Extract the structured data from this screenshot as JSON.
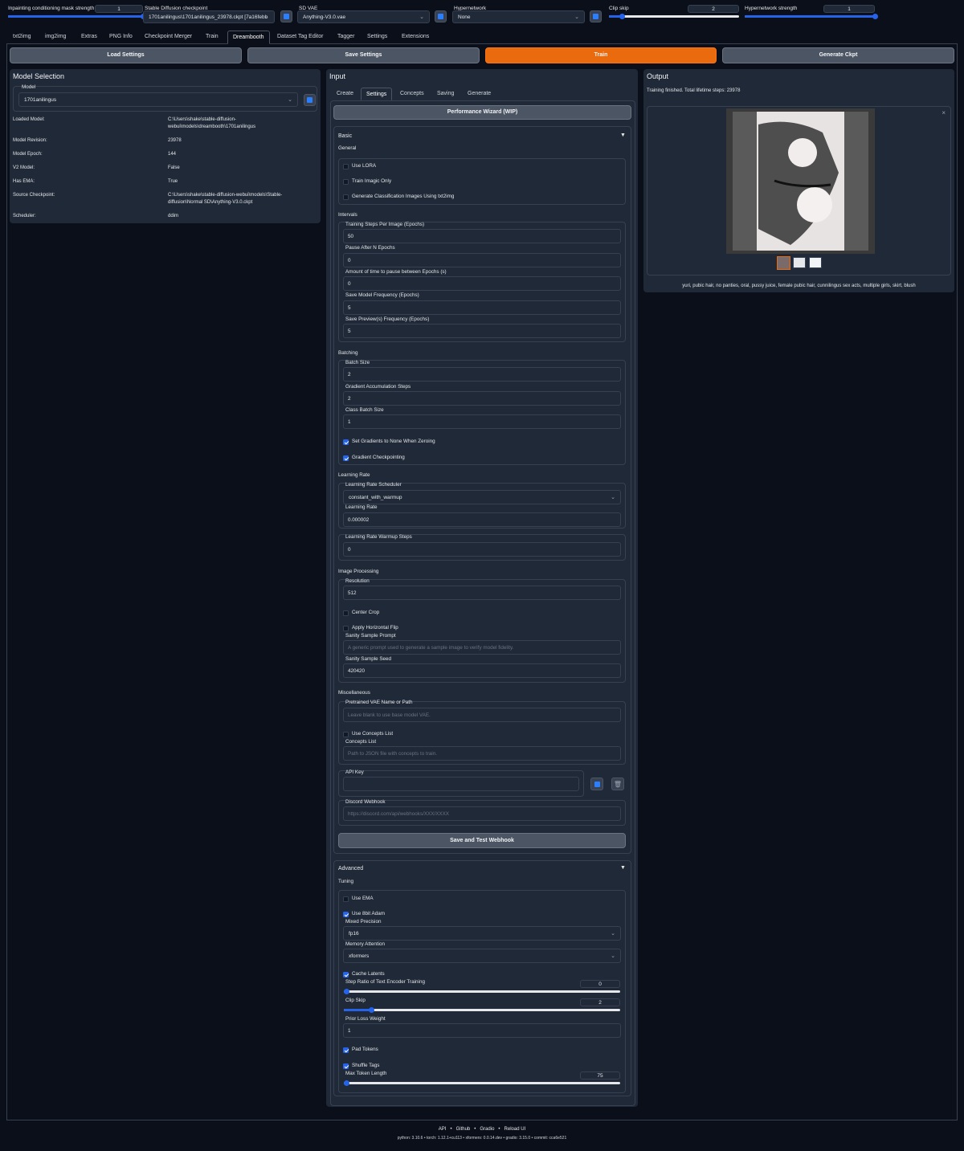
{
  "topbar": {
    "inpaint_label": "Inpainting conditioning mask strength",
    "inpaint_value": "1",
    "inpaint_level": 1.0,
    "ckpt_label": "Stable Diffusion checkpoint",
    "ckpt_value": "1701anilingus\\1701anilingus_23978.ckpt [7a16febb",
    "vae_label": "SD VAE",
    "vae_value": "Anything-V3.0.vae",
    "hyper_label": "Hypernetwork",
    "hyper_value": "None",
    "clipskip_label": "Clip skip",
    "clipskip_value": "2",
    "clipskip_level": 0.1,
    "hyperstr_label": "Hypernetwork strength",
    "hyperstr_value": "1",
    "hyperstr_level": 1.0
  },
  "tabs": [
    "txt2img",
    "img2img",
    "Extras",
    "PNG Info",
    "Checkpoint Merger",
    "Train",
    "Dreambooth",
    "Dataset Tag Editor",
    "Tagger",
    "Settings",
    "Extensions"
  ],
  "actions": {
    "load": "Load Settings",
    "save": "Save Settings",
    "train": "Train",
    "generate": "Generate Ckpt"
  },
  "model_selection": {
    "title": "Model Selection",
    "model_label": "Model",
    "model_value": "1701anilingus",
    "info": [
      {
        "k": "Loaded Model:",
        "v": "C:\\Users\\shake\\stable-diffusion-webui\\models\\dreambooth\\1701anilingus"
      },
      {
        "k": "Model Revision:",
        "v": "23978"
      },
      {
        "k": "Model Epoch:",
        "v": "144"
      },
      {
        "k": "V2 Model:",
        "v": "False"
      },
      {
        "k": "Has EMA:",
        "v": "True"
      },
      {
        "k": "Source Checkpoint:",
        "v": "C:\\Users\\shake\\stable-diffusion-webui\\models\\Stable-diffusion\\Normal SD\\Anything-V3.0.ckpt"
      },
      {
        "k": "Scheduler:",
        "v": "ddim"
      }
    ]
  },
  "input": {
    "title": "Input",
    "tabs": [
      "Create",
      "Settings",
      "Concepts",
      "Saving",
      "Generate"
    ],
    "wizard": "Performance Wizard (WIP)",
    "basic": "Basic",
    "general": "General",
    "use_lora": "Use LORA",
    "train_imagic": "Train Imagic Only",
    "gen_class": "Generate Classification Images Using txt2img",
    "intervals": "Intervals",
    "steps_label": "Training Steps Per Image (Epochs)",
    "steps_value": "50",
    "pause_label": "Pause After N Epochs",
    "pause_value": "0",
    "pause_time_label": "Amount of time to pause between Epochs (s)",
    "pause_time_value": "0",
    "save_model_label": "Save Model Frequency (Epochs)",
    "save_model_value": "5",
    "save_preview_label": "Save Preview(s) Frequency (Epochs)",
    "save_preview_value": "5",
    "batching": "Batching",
    "batch_label": "Batch Size",
    "batch_value": "2",
    "grad_accum_label": "Gradient Accumulation Steps",
    "grad_accum_value": "2",
    "class_batch_label": "Class Batch Size",
    "class_batch_value": "1",
    "set_grad_none": "Set Gradients to None When Zeroing",
    "grad_ckpt": "Gradient Checkpointing",
    "lr_section": "Learning Rate",
    "lr_sched_label": "Learning Rate Scheduler",
    "lr_sched_value": "constant_with_warmup",
    "lr_label": "Learning Rate",
    "lr_value": "0.000002",
    "warmup_label": "Learning Rate Warmup Steps",
    "warmup_value": "0",
    "img_proc": "Image Processing",
    "res_label": "Resolution",
    "res_value": "512",
    "center_crop": "Center Crop",
    "hflip": "Apply Horizontal Flip",
    "sanity_prompt_label": "Sanity Sample Prompt",
    "sanity_prompt_ph": "A generic prompt used to generate a sample image to verify model fidelity.",
    "sanity_seed_label": "Sanity Sample Seed",
    "sanity_seed_value": "420420",
    "misc": "Miscellaneous",
    "vae_path_label": "Pretrained VAE Name or Path",
    "vae_path_ph": "Leave blank to use base model VAE.",
    "use_concepts": "Use Concepts List",
    "concepts_label": "Concepts List",
    "concepts_ph": "Path to JSON file with concepts to train.",
    "api_key_label": "API Key",
    "discord_label": "Discord Webhook",
    "discord_ph": "https://discord.com/api/webhooks/XXX/XXXX",
    "test_webhook": "Save and Test Webhook",
    "advanced": "Advanced",
    "tuning": "Tuning",
    "use_ema": "Use EMA",
    "use_8bit": "Use 8bit Adam",
    "precision_label": "Mixed Precision",
    "precision_value": "fp16",
    "mem_label": "Memory Attention",
    "mem_value": "xformers",
    "cache_latents": "Cache Latents",
    "step_ratio_label": "Step Ratio of Text Encoder Training",
    "step_ratio_value": "0",
    "step_ratio_level": 0.0,
    "clip_label": "Clip Skip",
    "clip_value": "2",
    "clip_level": 0.1,
    "prior_label": "Prior Loss Weight",
    "prior_value": "1",
    "pad_tokens": "Pad Tokens",
    "shuffle_tags": "Shuffle Tags",
    "max_token_label": "Max Token Length",
    "max_token_value": "75",
    "max_token_level": 0.0
  },
  "output": {
    "title": "Output",
    "status": "Training finished. Total lifetime steps: 23978",
    "caption": "yuri, pubic hair, no panties, oral, pussy juice, female pubic hair, cunnilingus sex acts, multiple girls, skirt, blush"
  },
  "footer": {
    "links": [
      "API",
      "Github",
      "Gradio",
      "Reload UI"
    ],
    "versions": "python: 3.10.6  •  torch: 1.12.1+cu113  •  xformers: 0.0.14.dev  •  gradio: 3.15.0  •  commit: cca6e521"
  }
}
